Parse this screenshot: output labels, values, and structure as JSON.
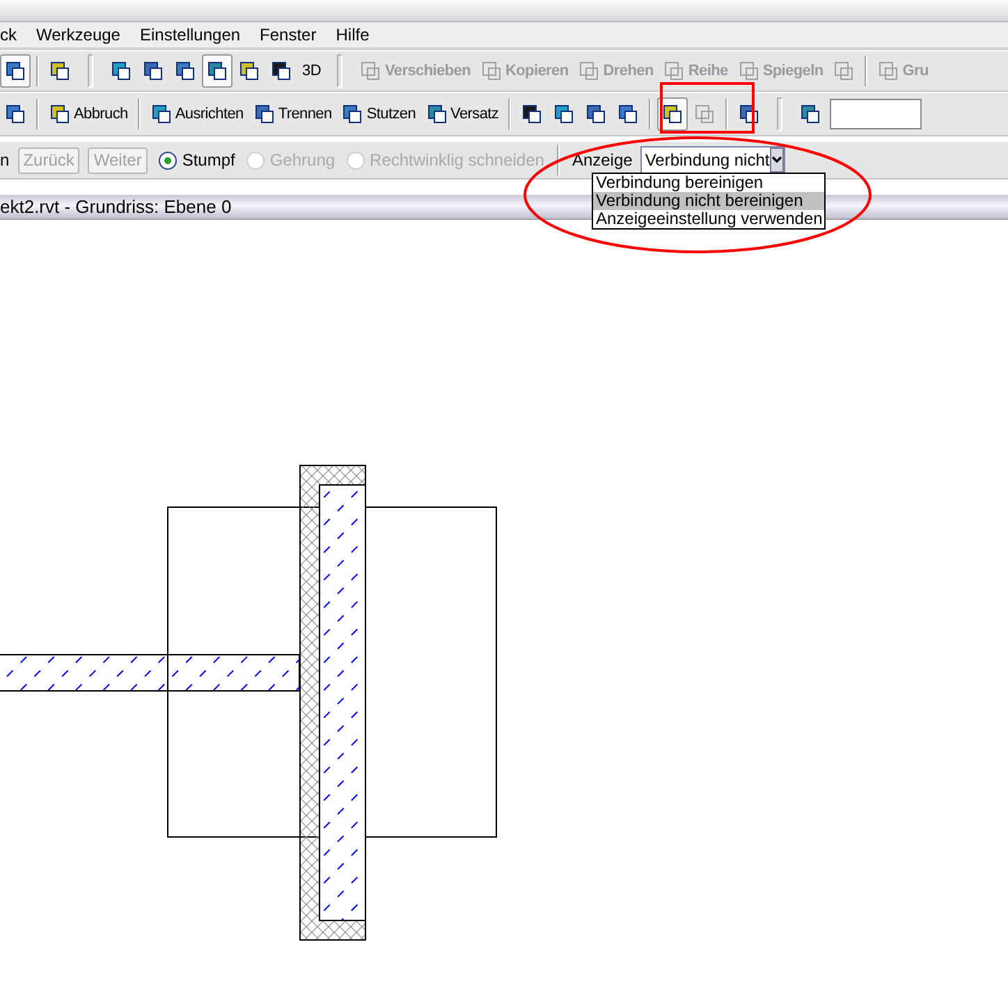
{
  "menu": [
    "ck",
    "Werkzeuge",
    "Einstellungen",
    "Fenster",
    "Hilfe"
  ],
  "toolbar_1": [
    {
      "kind": "icon",
      "pressed": true
    },
    {
      "kind": "sep"
    },
    {
      "kind": "icon",
      "pressed": false
    },
    {
      "kind": "grip"
    },
    {
      "kind": "icon",
      "pressed": false
    },
    {
      "kind": "icon",
      "pressed": false
    },
    {
      "kind": "icon",
      "pressed": false
    },
    {
      "kind": "icon",
      "pressed": true
    },
    {
      "kind": "icon",
      "pressed": false
    },
    {
      "kind": "icon",
      "pressed": false
    },
    {
      "kind": "text",
      "label": "3D",
      "disabled": false
    },
    {
      "kind": "grip"
    },
    {
      "kind": "labeled",
      "label": "Verschieben",
      "disabled": true
    },
    {
      "kind": "labeled",
      "label": "Kopieren",
      "disabled": true
    },
    {
      "kind": "labeled",
      "label": "Drehen",
      "disabled": true
    },
    {
      "kind": "labeled",
      "label": "Reihe",
      "disabled": true
    },
    {
      "kind": "labeled",
      "label": "Spiegeln",
      "disabled": true
    },
    {
      "kind": "icon",
      "pressed": false,
      "disabled": true
    },
    {
      "kind": "sep"
    },
    {
      "kind": "labeled",
      "label": "Gru",
      "disabled": true
    }
  ],
  "toolbar_2": [
    {
      "kind": "icon",
      "pressed": false
    },
    {
      "kind": "sep"
    },
    {
      "kind": "labeled",
      "label": "Abbruch",
      "disabled": false
    },
    {
      "kind": "sep"
    },
    {
      "kind": "labeled",
      "label": "Ausrichten",
      "disabled": false
    },
    {
      "kind": "labeled",
      "label": "Trennen",
      "disabled": false
    },
    {
      "kind": "labeled",
      "label": "Stutzen",
      "disabled": false
    },
    {
      "kind": "labeled",
      "label": "Versatz",
      "disabled": false
    },
    {
      "kind": "sep"
    },
    {
      "kind": "icon",
      "pressed": false
    },
    {
      "kind": "icon",
      "pressed": false
    },
    {
      "kind": "icon",
      "pressed": false
    },
    {
      "kind": "icon",
      "pressed": false
    },
    {
      "kind": "sep"
    },
    {
      "kind": "icon",
      "pressed": true
    },
    {
      "kind": "icon",
      "pressed": false,
      "disabled": true
    },
    {
      "kind": "sep"
    },
    {
      "kind": "icon",
      "pressed": false
    },
    {
      "kind": "grip"
    },
    {
      "kind": "icon",
      "pressed": false
    },
    {
      "kind": "field"
    }
  ],
  "options_bar": {
    "cut_label": "n",
    "buttons": [
      {
        "label": "Zurück",
        "disabled": true
      },
      {
        "label": "Weiter",
        "disabled": true
      }
    ],
    "radios": [
      {
        "label": "Stumpf",
        "selected": true,
        "disabled": false
      },
      {
        "label": "Gehrung",
        "selected": false,
        "disabled": true
      },
      {
        "label": "Rechtwinklig schneiden",
        "selected": false,
        "disabled": true
      }
    ],
    "display_label": "Anzeige",
    "dropdown": {
      "value": "Verbindung nicht",
      "expanded": true,
      "options": [
        {
          "label": "Verbindung bereinigen",
          "selected": false
        },
        {
          "label": "Verbindung nicht bereinigen",
          "selected": true
        },
        {
          "label": "Anzeigeeinstellung verwenden",
          "selected": false
        }
      ]
    }
  },
  "view": {
    "title": "ekt2.rvt - Grundriss: Ebene 0"
  }
}
